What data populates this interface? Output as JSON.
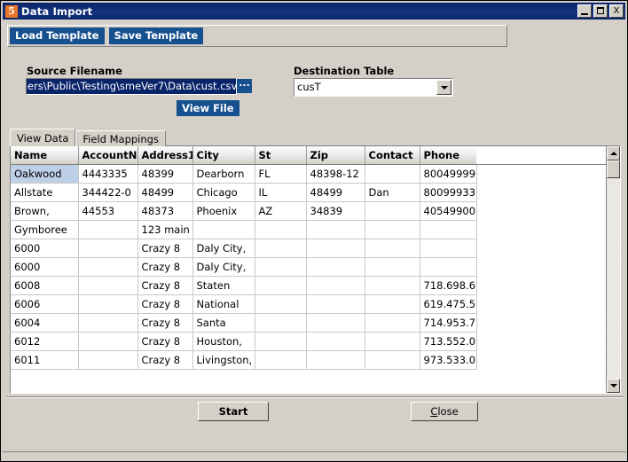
{
  "window": {
    "title": "Data Import",
    "icon": "5",
    "controls": {
      "minimize": "_",
      "maximize": "□",
      "close": "X"
    }
  },
  "toolbar": {
    "load_template_label": "Load Template",
    "save_template_label": "Save Template"
  },
  "source": {
    "label": "Source Filename",
    "value": "ers\\Public\\Testing\\smeVer7\\Data\\cust.csv",
    "browse_label": "...",
    "view_file_label": "View File"
  },
  "destination": {
    "label": "Destination Table",
    "value": "cusT",
    "options": [
      "cusT"
    ]
  },
  "tabs": [
    {
      "label": "View Data",
      "active": true
    },
    {
      "label": "Field Mappings",
      "active": false
    }
  ],
  "grid": {
    "columns": [
      "Name",
      "AccountN",
      "Address1",
      "City",
      "St",
      "Zip",
      "Contact",
      "Phone"
    ],
    "rows": [
      [
        "Oakwood",
        "4443335",
        "48399",
        "Dearborn",
        "FL",
        "48398-12",
        "",
        "80049999"
      ],
      [
        "Allstate",
        "344422-0",
        "48499",
        "Chicago",
        "IL",
        "48499",
        "Dan",
        "80099933"
      ],
      [
        "Brown,",
        "44553",
        "48373",
        "Phoenix",
        "AZ",
        "34839",
        "",
        "40549900"
      ],
      [
        "Gymboree",
        "",
        "123 main",
        "",
        "",
        "",
        "",
        ""
      ],
      [
        "6000",
        "",
        "Crazy 8",
        "Daly City,",
        "",
        "",
        "",
        ""
      ],
      [
        "6000",
        "",
        "Crazy 8",
        "Daly City,",
        "",
        "",
        "",
        ""
      ],
      [
        "6008",
        "",
        "Crazy 8",
        "Staten",
        "",
        "",
        "",
        "718.698.6"
      ],
      [
        "6006",
        "",
        "Crazy 8",
        "National",
        "",
        "",
        "",
        "619.475.5"
      ],
      [
        "6004",
        "",
        "Crazy 8",
        "Santa",
        "",
        "",
        "",
        "714.953.7"
      ],
      [
        "6012",
        "",
        "Crazy 8",
        "Houston,",
        "",
        "",
        "",
        "713.552.0"
      ],
      [
        "6011",
        "",
        "Crazy 8",
        "Livingston,",
        "",
        "",
        "",
        "973.533.0"
      ]
    ],
    "selected_cell": {
      "row": 0,
      "col": 0
    }
  },
  "actions": {
    "start_label": "Start",
    "close_mnemonic": "C",
    "close_rest": "lose"
  },
  "colors": {
    "titlebar": "#0a2a72",
    "accent_button": "#17508f",
    "face": "#d4d0c8",
    "selection": "#0a246a",
    "cell_selection": "#bdd0e8",
    "app_icon": "#e8762b"
  }
}
